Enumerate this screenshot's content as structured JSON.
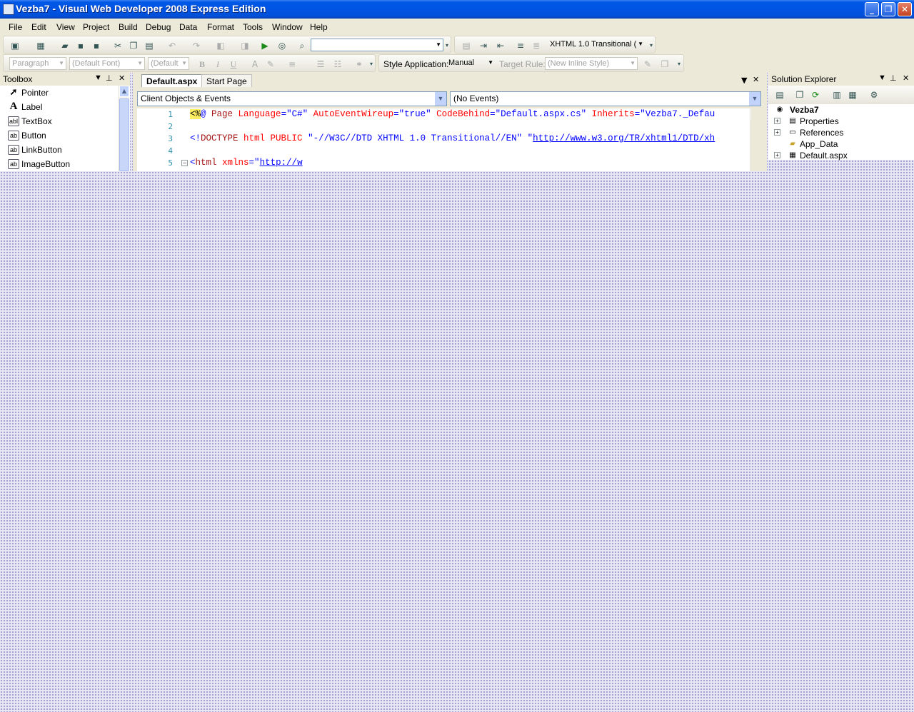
{
  "window": {
    "title": "Vezba7 - Visual Web Developer 2008 Express Edition",
    "minimize_label": "_",
    "restore_label": "❐",
    "close_label": "✕"
  },
  "menu": [
    "File",
    "Edit",
    "View",
    "Project",
    "Build",
    "Debug",
    "Data",
    "Format",
    "Tools",
    "Window",
    "Help"
  ],
  "toolbar": {
    "doc_type": "XHTML 1.0 Transitional (",
    "block_format": "Paragraph",
    "font_name": "(Default Font)",
    "font_size": "(Default",
    "bold": "B",
    "italic": "I",
    "underline": "U",
    "style_application_label": "Style Application:",
    "style_application_value": "Manual",
    "target_rule_label": "Target Rule:",
    "target_rule_value": "(New Inline Style)"
  },
  "toolbox": {
    "title": "Toolbox",
    "items": [
      {
        "label": "Pointer",
        "icon": "➚"
      },
      {
        "label": "Label",
        "icon": "A"
      },
      {
        "label": "TextBox",
        "icon": "abl"
      },
      {
        "label": "Button",
        "icon": "ab"
      },
      {
        "label": "LinkButton",
        "icon": "ab"
      },
      {
        "label": "ImageButton",
        "icon": "ab"
      }
    ]
  },
  "editor": {
    "tabs": [
      {
        "label": "Default.aspx",
        "active": true
      },
      {
        "label": "Start Page",
        "active": false
      }
    ],
    "objects_dropdown": "Client Objects & Events",
    "events_dropdown": "(No Events)",
    "line_numbers": [
      "1",
      "2",
      "3",
      "4",
      "5"
    ],
    "code": {
      "l1_open": "<%",
      "l1_at": "@",
      "l1_page": " Page",
      "l1_a1": " Language",
      "l1_v1": "=\"C#\"",
      "l1_a2": " AutoEventWireup",
      "l1_v2": "=\"true\"",
      "l1_a3": " CodeBehind",
      "l1_v3": "=\"Default.aspx.cs\"",
      "l1_a4": " Inherits",
      "l1_v4": "=\"Vezba7._Defau",
      "l3_open": "<!",
      "l3_doctype": "DOCTYPE",
      "l3_html": " html",
      "l3_public": " PUBLIC",
      "l3_fpi": " \"-//W3C//DTD XHTML 1.0 Transitional//EN\"",
      "l3_q": " \"",
      "l3_url": "http://www.w3.org/TR/xhtml1/DTD/xh",
      "l5_open": "<",
      "l5_html": "html",
      "l5_attr": " xmlns",
      "l5_eq": "=\"",
      "l5_url": "http://w"
    }
  },
  "solution_explorer": {
    "title": "Solution Explorer",
    "project": "Vezba7",
    "items": [
      {
        "label": "Properties",
        "expander": "+",
        "icon": "▤"
      },
      {
        "label": "References",
        "expander": "+",
        "icon": "▭"
      },
      {
        "label": "App_Data",
        "expander": "",
        "icon": "▰"
      },
      {
        "label": "Default.aspx",
        "expander": "+",
        "icon": "▦"
      }
    ]
  },
  "colors": {
    "titlebar": "#0054e3",
    "chrome": "#ece9d8",
    "desktop_dots": "#8c8cbe",
    "code_element": "#a31515",
    "code_attribute": "#ff0000",
    "code_value": "#0000ff",
    "line_number": "#2b91af"
  }
}
